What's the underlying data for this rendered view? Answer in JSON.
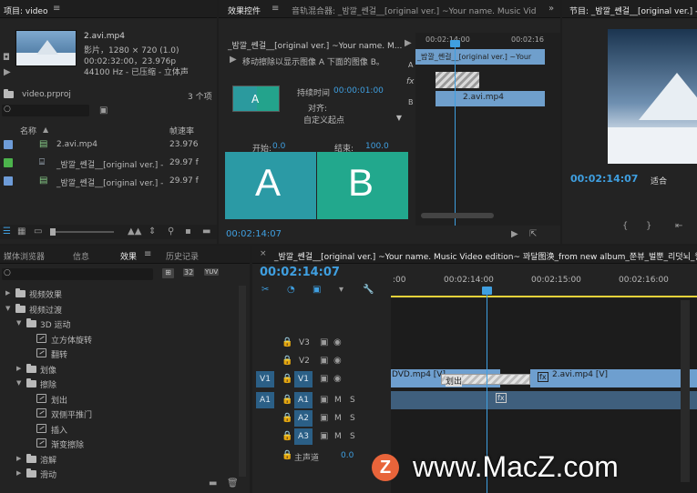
{
  "project": {
    "title": "项目: video",
    "clip_name": "2.avi.mp4",
    "info1": "影片，1280 × 720 (1.0)",
    "info2": "00:02:32:00，23.976p",
    "info3": "44100 Hz - 已压缩 - 立体声",
    "file": "video.prproj",
    "count": "3 个项",
    "col_name": "名称",
    "col_fps": "帧速率",
    "rows": [
      {
        "name": "2.avi.mp4",
        "fps": "23.976",
        "color": "#6e9cd8"
      },
      {
        "name": "_밤깔_쎈걸__[original ver.] -",
        "fps": "29.97 f",
        "color": "#4cb34c"
      },
      {
        "name": "_밤깔_쎈걸__[original ver.] -",
        "fps": "29.97 f",
        "color": "#6e9cd8"
      }
    ]
  },
  "effects_controls": {
    "tab": "效果控件",
    "tab2": "音轨混合器: _밤깔_쎈걸__[original ver.] ~Your name. Music Vid",
    "clip_title": "_밤깔_쎈걸__[original ver.] ~Your name. M...",
    "description": "移动擦除以显示图像 A 下面的图像 B。",
    "duration_label": "持续时间",
    "duration_value": "00:00:01:00",
    "align_label": "对齐:",
    "align_value": "自定义起点",
    "start_label": "开始:",
    "start_value": "0.0",
    "end_label": "结束:",
    "end_value": "100.0",
    "a_label": "A",
    "b_label": "B",
    "thumb_label": "A",
    "time": "00:02:14:07",
    "mini_time1": "00:02:14:00",
    "mini_time2": "00:02:16",
    "mini_clip1": "_밤깔_쎈걸__[original ver.] ~Your",
    "mini_clip2": "2.avi.mp4",
    "row_a": "A",
    "row_b": "B",
    "fx": "fx"
  },
  "program": {
    "title": "节目: _밤깔_쎈걸__[original ver.] -",
    "time": "00:02:14:07",
    "fit": "适合"
  },
  "effects_panel": {
    "tabs": [
      "媒体浏览器",
      "信息",
      "效果",
      "历史记录"
    ],
    "active_tab": "效果",
    "badges": [
      "32",
      "YUV"
    ],
    "tree": [
      {
        "label": "视频效果",
        "level": 0,
        "type": "folder",
        "open": false
      },
      {
        "label": "视频过渡",
        "level": 0,
        "type": "folder",
        "open": true
      },
      {
        "label": "3D 运动",
        "level": 1,
        "type": "folder",
        "open": true
      },
      {
        "label": "立方体旋转",
        "level": 2,
        "type": "fx"
      },
      {
        "label": "翻转",
        "level": 2,
        "type": "fx"
      },
      {
        "label": "划像",
        "level": 1,
        "type": "folder",
        "open": false
      },
      {
        "label": "擦除",
        "level": 1,
        "type": "folder",
        "open": true
      },
      {
        "label": "划出",
        "level": 2,
        "type": "fx"
      },
      {
        "label": "双侧平推门",
        "level": 2,
        "type": "fx"
      },
      {
        "label": "插入",
        "level": 2,
        "type": "fx"
      },
      {
        "label": "渐变擦除",
        "level": 2,
        "type": "fx"
      },
      {
        "label": "溶解",
        "level": 1,
        "type": "folder",
        "open": false
      },
      {
        "label": "滑动",
        "level": 1,
        "type": "folder",
        "open": false
      }
    ]
  },
  "timeline": {
    "title": "_밤깔_쎈걸__[original ver.] ~Your name. Music Video edition~ 꽈달图涣_from new album_쭌뷰_벌뿐_리덧뇌_월섬티",
    "time": "00:02:14:07",
    "ruler": [
      ":00",
      "00:02:14:00",
      "00:02:15:00",
      "00:02:16:00"
    ],
    "tracks": {
      "v3": "V3",
      "v2": "V2",
      "v1_src": "V1",
      "v1": "V1",
      "a1_src": "A1",
      "a1": "A1",
      "a2": "A2",
      "a3": "A3",
      "m": "M",
      "s": "S",
      "master": "主声道",
      "master_val": "0.0"
    },
    "clips": {
      "dvd": "DVD.mp4 [V]",
      "transition": "划出",
      "clip2": "2.avi.mp4 [V]"
    }
  },
  "watermark": {
    "letter": "Z",
    "text": "www.MacZ.com"
  }
}
